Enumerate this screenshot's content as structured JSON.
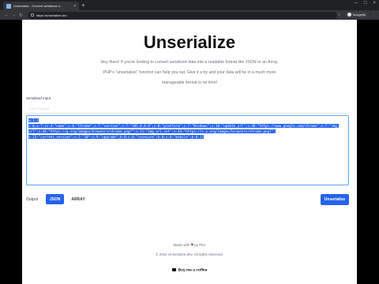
{
  "browser": {
    "tab_title": "Unserialize - Convert serialized d...",
    "url": "https://unserialize.dev",
    "profile_name": "Incognito"
  },
  "page": {
    "title": "Unserialize",
    "description": "Hey there! If you're looking to convert serialized data into a readable format like JSON or an Array, PHP's \"unserialize\" function can help you out. Give it a try and your data will be in a much more manageable format in no time!",
    "serialized_label": "Serialized Input",
    "placeholder": "Enter Payload",
    "input_lines": [
      "a:1:{",
      "i:0;a:7:{s:4:\"name\";s:6:\"Chrome\";s:7:\"version\";s:7:\"105.0.0.0\";s:8:\"platform\";s:7:\"Windows\";s:10:\"update_url\";s:36:\"https://www.google.com/chrome\";s:7:\"img_",
      "url\";s:44:\"https://g.org/images/browsers/chrome.png?\";s:11:\"img_url_cnt\";s:43:\"https://s.o.org/images/browsers/chrome.png?\";",
      "s:15:\"current_version\";s:2:\"10\";s:9:\"upgrade\";b:0;s:6:\"insecure\";b:0;s:6:\"mobile\";b:0;}}"
    ],
    "output_label": "Output",
    "json_btn": "JSON",
    "array_btn": "ARRAY",
    "unserialize_btn": "Unserialize",
    "made_with_prefix": "Made with",
    "made_with_suffix": "by Pier",
    "copyright": "© 2022 Unserialize.dev. All rights reserved.",
    "coffee": "Buy me a coffee"
  }
}
